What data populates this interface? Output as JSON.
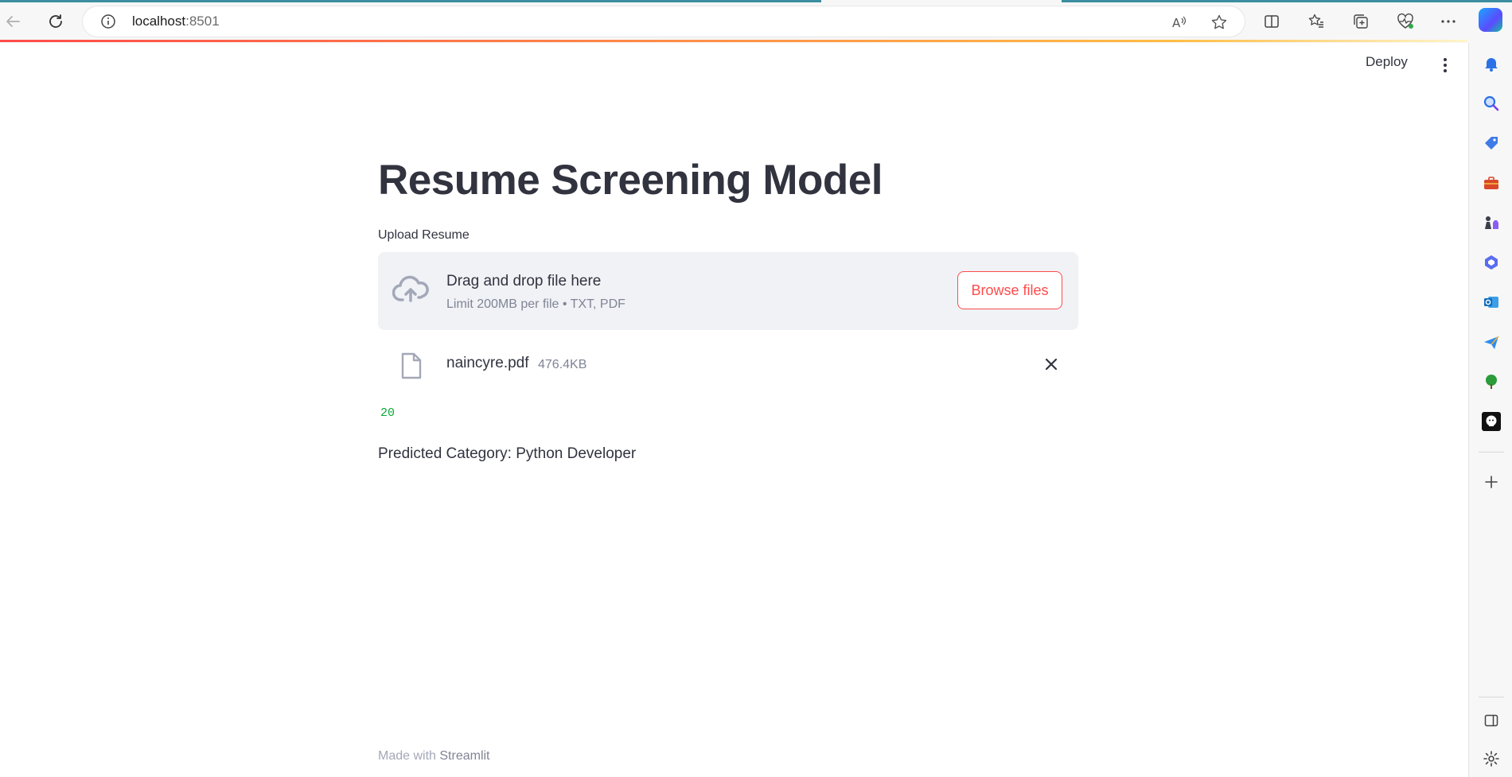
{
  "browser": {
    "url_host": "localhost",
    "url_port": ":8501"
  },
  "header": {
    "deploy_label": "Deploy"
  },
  "main": {
    "title": "Resume Screening Model",
    "upload_label": "Upload Resume",
    "dropzone": {
      "title": "Drag and drop file here",
      "subtitle": "Limit 200MB per file • TXT, PDF",
      "browse_label": "Browse files"
    },
    "uploaded_file": {
      "name": "naincyre.pdf",
      "size": "476.4KB"
    },
    "output_code": "20",
    "prediction": "Predicted Category: Python Developer"
  },
  "footer": {
    "prefix": "Made with ",
    "brand": "Streamlit"
  },
  "colors": {
    "accent": "#ff4b4b",
    "text": "#31333f",
    "muted": "#808495",
    "dropzone_bg": "#f0f2f6",
    "code_green": "#09ab3b"
  }
}
